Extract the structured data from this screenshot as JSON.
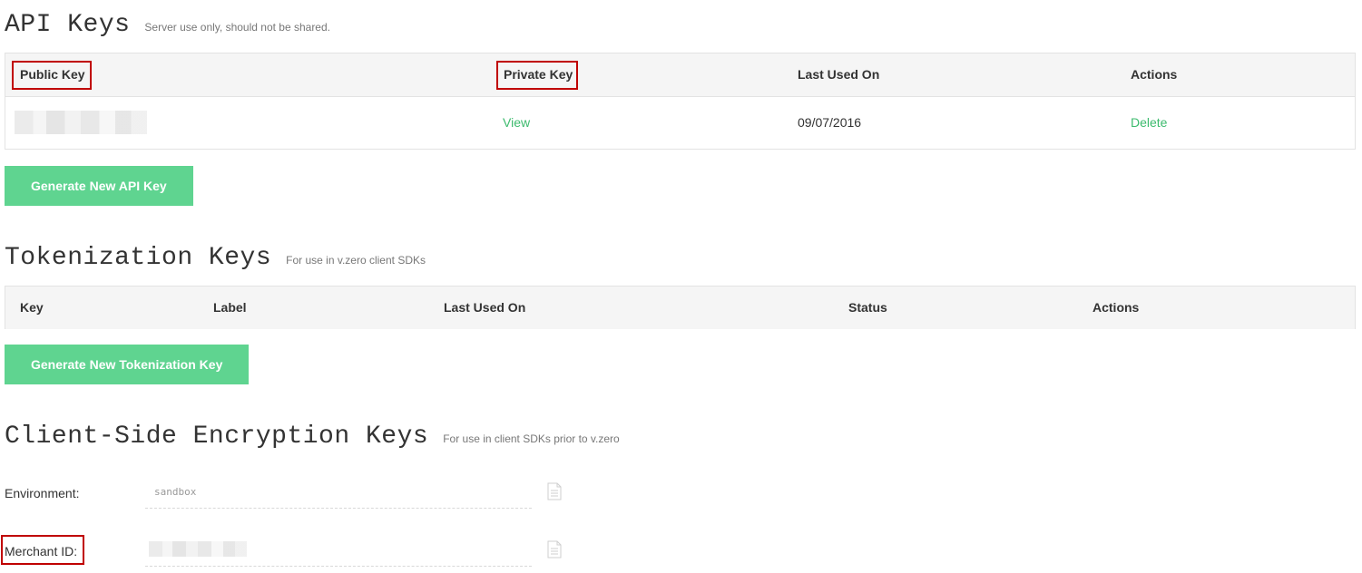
{
  "api_keys": {
    "title": "API Keys",
    "subtitle": "Server use only, should not be shared.",
    "columns": [
      "Public Key",
      "Private Key",
      "Last Used On",
      "Actions"
    ],
    "rows": [
      {
        "public_key": "",
        "private_key_action": "View",
        "last_used_on": "09/07/2016",
        "action": "Delete"
      }
    ],
    "generate_button": "Generate New API Key"
  },
  "tokenization_keys": {
    "title": "Tokenization Keys",
    "subtitle": "For use in v.zero client SDKs",
    "columns": [
      "Key",
      "Label",
      "Last Used On",
      "Status",
      "Actions"
    ],
    "generate_button": "Generate New Tokenization Key"
  },
  "cse_keys": {
    "title": "Client-Side Encryption Keys",
    "subtitle": "For use in client SDKs prior to v.zero",
    "fields": [
      {
        "label": "Environment:",
        "value": "sandbox"
      },
      {
        "label": "Merchant ID:",
        "value": ""
      }
    ]
  },
  "colors": {
    "accent_button": "#5fd490",
    "link": "#3dbb6e",
    "highlight_box": "#c00000"
  }
}
